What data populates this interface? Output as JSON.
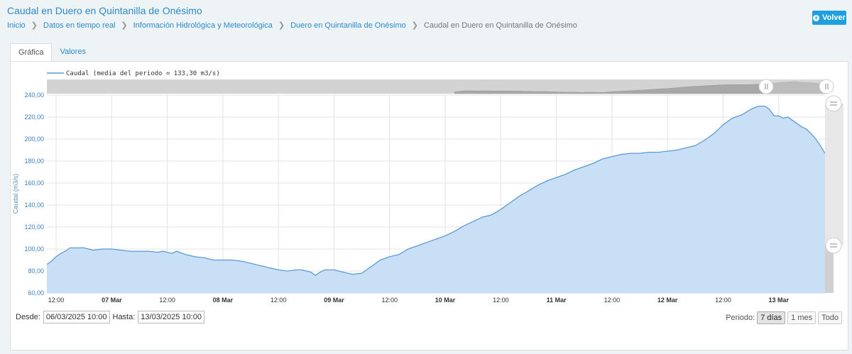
{
  "page": {
    "title": "Caudal en Duero en Quintanilla de Onésimo",
    "back_label": "Volver"
  },
  "breadcrumb": [
    "Inicio",
    "Datos en tiempo real",
    "Información Hidrológica y Meteorológica",
    "Duero en Quintanilla de Onésimo",
    "Caudal en Duero en Quintanilla de Onésimo"
  ],
  "tabs": [
    {
      "label": "Gráfica",
      "active": true
    },
    {
      "label": "Valores",
      "active": false
    }
  ],
  "controls": {
    "from_label": "Desde:",
    "from_value": "06/03/2025 10:00",
    "to_label": "Hasta:",
    "to_value": "13/03/2025 10:00",
    "period_label": "Periodo:",
    "periods": [
      {
        "label": "7 días",
        "active": true
      },
      {
        "label": "1 mes",
        "active": false
      },
      {
        "label": "Todo",
        "active": false
      }
    ]
  },
  "colors": {
    "line": "#5b9bd5",
    "fill": "#c9dff5",
    "accent": "#1e9fe0"
  },
  "chart_data": {
    "type": "area",
    "legend": "Caudal (media del periodo = 133,30 m3/s)",
    "legend_position": "top-left",
    "ylabel": "Caudal (m3/s)",
    "ylim": [
      60,
      240
    ],
    "yticks": [
      "60,00",
      "80,00",
      "100,00",
      "120,00",
      "140,00",
      "160,00",
      "180,00",
      "200,00",
      "220,00",
      "240,00"
    ],
    "xlim_hours": [
      0,
      168
    ],
    "xticks": [
      {
        "h": 2,
        "label": "12:00",
        "bold": false
      },
      {
        "h": 14,
        "label": "07 Mar",
        "bold": true
      },
      {
        "h": 26,
        "label": "12:00",
        "bold": false
      },
      {
        "h": 38,
        "label": "08 Mar",
        "bold": true
      },
      {
        "h": 50,
        "label": "12:00",
        "bold": false
      },
      {
        "h": 62,
        "label": "09 Mar",
        "bold": true
      },
      {
        "h": 74,
        "label": "12:00",
        "bold": false
      },
      {
        "h": 86,
        "label": "10 Mar",
        "bold": true
      },
      {
        "h": 98,
        "label": "12:00",
        "bold": false
      },
      {
        "h": 110,
        "label": "11 Mar",
        "bold": true
      },
      {
        "h": 122,
        "label": "12:00",
        "bold": false
      },
      {
        "h": 134,
        "label": "12 Mar",
        "bold": true
      },
      {
        "h": 146,
        "label": "12:00",
        "bold": false
      },
      {
        "h": 158,
        "label": "13 Mar",
        "bold": true
      }
    ],
    "x_hours": [
      0,
      1,
      2,
      3,
      4,
      5,
      6,
      8,
      10,
      12,
      14,
      16,
      18,
      20,
      22,
      24,
      25,
      26,
      27,
      28,
      30,
      32,
      34,
      36,
      38,
      40,
      42,
      44,
      46,
      48,
      50,
      52,
      54,
      55,
      56,
      57,
      58,
      59,
      60,
      61,
      62,
      63,
      64,
      66,
      68,
      70,
      72,
      74,
      76,
      78,
      80,
      82,
      84,
      86,
      88,
      90,
      92,
      94,
      96,
      98,
      100,
      102,
      104,
      106,
      108,
      110,
      112,
      114,
      116,
      118,
      120,
      122,
      124,
      126,
      128,
      130,
      132,
      134,
      136,
      138,
      140,
      142,
      144,
      146,
      148,
      150,
      152,
      153,
      154,
      155,
      156,
      157,
      158,
      159,
      160,
      161,
      162,
      163,
      164,
      165,
      166,
      167,
      168
    ],
    "y_values": [
      86,
      89,
      93,
      96,
      98,
      101,
      101,
      101,
      99,
      100,
      100,
      99,
      98,
      98,
      98,
      97,
      98,
      97,
      96,
      98,
      95,
      93,
      92,
      90,
      90,
      90,
      89,
      87,
      85,
      83,
      81,
      80,
      81,
      81,
      80,
      79,
      76,
      79,
      81,
      81,
      81,
      80,
      79,
      77,
      78,
      84,
      90,
      93,
      95,
      100,
      103,
      106,
      109,
      112,
      116,
      121,
      125,
      129,
      131,
      136,
      142,
      148,
      153,
      158,
      162,
      165,
      168,
      172,
      175,
      178,
      182,
      184,
      186,
      187,
      187,
      188,
      188,
      189,
      190,
      192,
      194,
      199,
      205,
      213,
      219,
      222,
      227,
      229,
      230,
      230,
      227,
      221,
      221,
      219,
      220,
      217,
      214,
      211,
      209,
      205,
      200,
      194,
      187
    ]
  }
}
